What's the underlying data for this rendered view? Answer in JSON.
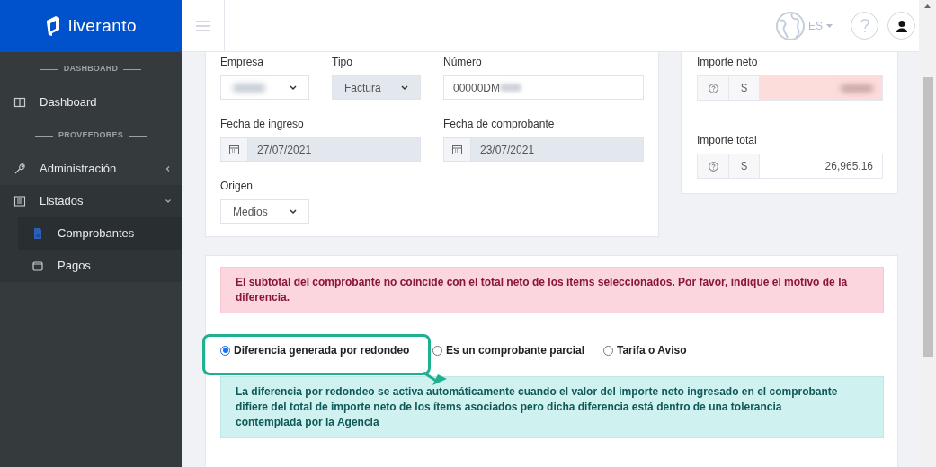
{
  "brand": {
    "name": "liveranto"
  },
  "sidebar": {
    "sections": [
      {
        "heading": "DASHBOARD",
        "items": [
          {
            "label": "Dashboard"
          }
        ]
      },
      {
        "heading": "PROVEEDORES",
        "items": [
          {
            "label": "Administración",
            "expanded": false
          },
          {
            "label": "Listados",
            "expanded": true,
            "children": [
              {
                "label": "Comprobantes",
                "selected": true
              },
              {
                "label": "Pagos",
                "selected": false
              }
            ]
          }
        ]
      }
    ]
  },
  "header": {
    "language": "ES"
  },
  "form": {
    "fields": [
      {
        "label": "Empresa",
        "kind": "select",
        "redacted": true
      },
      {
        "label": "Tipo",
        "kind": "select",
        "value": "Factura",
        "disabled": true
      },
      {
        "label": "Número",
        "kind": "text",
        "value": "00000DM",
        "redacted": true
      },
      {
        "label": "Fecha de ingreso",
        "kind": "date",
        "value": "27/07/2021",
        "disabled": true
      },
      {
        "label": "Fecha de comprobante",
        "kind": "date",
        "value": "23/07/2021",
        "disabled": true
      },
      {
        "label": "Origen",
        "kind": "select",
        "value": "Medios",
        "disabled": false
      }
    ]
  },
  "amounts": [
    {
      "label": "Importe neto",
      "currency": "$",
      "redacted": true,
      "invalid": true
    },
    {
      "label": "Importe total",
      "currency": "$",
      "value": "26,965.16",
      "invalid": false
    }
  ],
  "difference": {
    "alert": "El subtotal del comprobante no coincide con el total neto de los ítems seleccionados. Por favor, indique el motivo de la diferencia.",
    "options": [
      {
        "label": "Diferencia generada por redondeo",
        "selected": true
      },
      {
        "label": "Es un comprobante parcial",
        "selected": false
      },
      {
        "label": "Tarifa o Aviso",
        "selected": false
      }
    ],
    "info": "La diferencia por redondeo se activa automáticamente cuando el valor del importe neto ingresado en el comprobante difiere del total de importe neto de los ítems asociados pero dicha diferencia está dentro de una tolerancia contemplada por la Agencia"
  }
}
